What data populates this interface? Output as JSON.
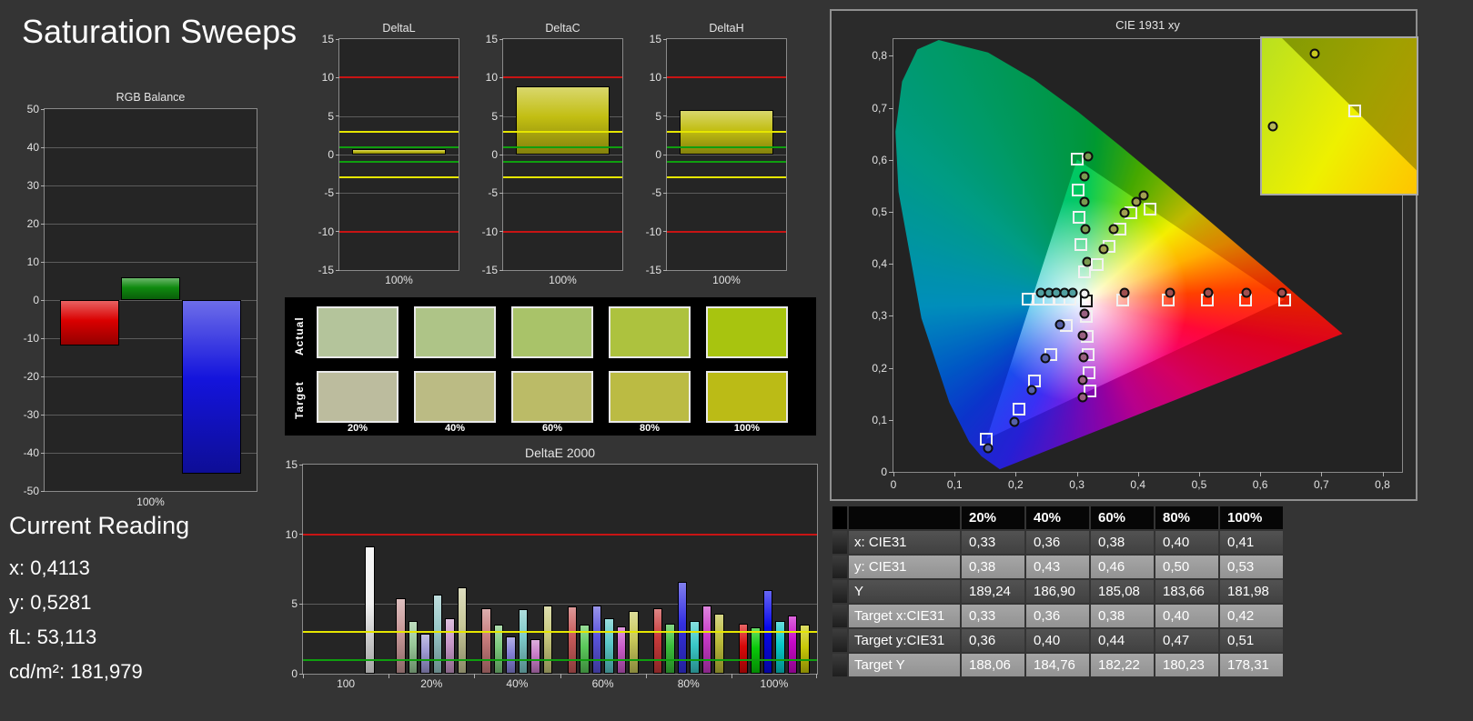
{
  "app": {
    "title": "Saturation Sweeps"
  },
  "current_reading": {
    "heading": "Current Reading",
    "x_label": "x: 0,4113",
    "y_label": "y: 0,5281",
    "fl_label": "fL: 53,113",
    "cdm2_label": "cd/m²: 181,979"
  },
  "colors": {
    "background": "#343434",
    "plot_background": "#252525",
    "reference_red": "#c81414",
    "reference_yellow": "#e6e600",
    "reference_green": "#0f9e0f",
    "grid": "#5c5c5c"
  },
  "chart_data": [
    {
      "id": "rgb_balance",
      "type": "bar",
      "title": "RGB Balance",
      "categories": [
        "Red",
        "Green",
        "Blue"
      ],
      "values": [
        -12,
        6,
        -45.5
      ],
      "bar_colors": [
        "#da0000",
        "#0f8a0f",
        "#1414dc"
      ],
      "ylim": [
        -50,
        50
      ],
      "yticks": [
        -50,
        -40,
        -30,
        -20,
        -10,
        0,
        10,
        20,
        30,
        40,
        50
      ],
      "xlabel": "100%"
    },
    {
      "id": "delta_l",
      "type": "bar",
      "title": "DeltaL",
      "categories": [
        "100%"
      ],
      "values": [
        0.7
      ],
      "bar_colors": [
        "#c2be12"
      ],
      "ylim": [
        -15,
        15
      ],
      "yticks": [
        -15,
        -10,
        -5,
        0,
        5,
        10,
        15
      ],
      "ref_lines": [
        {
          "y": 10,
          "color": "#c81414"
        },
        {
          "y": -10,
          "color": "#c81414"
        },
        {
          "y": 3,
          "color": "#e6e600"
        },
        {
          "y": -3,
          "color": "#e6e600"
        },
        {
          "y": 1,
          "color": "#0f9e0f"
        },
        {
          "y": -1,
          "color": "#0f9e0f"
        }
      ],
      "xlabel": "100%"
    },
    {
      "id": "delta_c",
      "type": "bar",
      "title": "DeltaC",
      "categories": [
        "100%"
      ],
      "values": [
        8.8
      ],
      "bar_colors": [
        "#c2be12"
      ],
      "ylim": [
        -15,
        15
      ],
      "yticks": [
        -15,
        -10,
        -5,
        0,
        5,
        10,
        15
      ],
      "ref_lines": [
        {
          "y": 10,
          "color": "#c81414"
        },
        {
          "y": -10,
          "color": "#c81414"
        },
        {
          "y": 3,
          "color": "#e6e600"
        },
        {
          "y": -3,
          "color": "#e6e600"
        },
        {
          "y": 1,
          "color": "#0f9e0f"
        },
        {
          "y": -1,
          "color": "#0f9e0f"
        }
      ],
      "xlabel": "100%"
    },
    {
      "id": "delta_h",
      "type": "bar",
      "title": "DeltaH",
      "categories": [
        "100%"
      ],
      "values": [
        5.8
      ],
      "bar_colors": [
        "#c2be12"
      ],
      "ylim": [
        -15,
        15
      ],
      "yticks": [
        -15,
        -10,
        -5,
        0,
        5,
        10,
        15
      ],
      "ref_lines": [
        {
          "y": 10,
          "color": "#c81414"
        },
        {
          "y": -10,
          "color": "#c81414"
        },
        {
          "y": 3,
          "color": "#e6e600"
        },
        {
          "y": -3,
          "color": "#e6e600"
        },
        {
          "y": 1,
          "color": "#0f9e0f"
        },
        {
          "y": -1,
          "color": "#0f9e0f"
        }
      ],
      "xlabel": "100%"
    },
    {
      "id": "delta_e2000",
      "type": "bar",
      "title": "DeltaE 2000",
      "ylim": [
        0,
        15
      ],
      "yticks": [
        0,
        5,
        10,
        15
      ],
      "ref_lines": [
        {
          "y": 10,
          "color": "#c81414"
        },
        {
          "y": 3,
          "color": "#e6e600"
        },
        {
          "y": 1,
          "color": "#0f9e0f"
        }
      ],
      "groups": [
        {
          "label": "100",
          "values": [
            9.1
          ],
          "colors": [
            "#f0f0f0"
          ]
        },
        {
          "label": "20%",
          "values": [
            5.4,
            3.8,
            2.9,
            5.7,
            4.0,
            6.2
          ],
          "colors": [
            "#c89898",
            "#98c898",
            "#9c98d2",
            "#98c8c8",
            "#c898c8",
            "#c8c898"
          ]
        },
        {
          "label": "40%",
          "values": [
            4.7,
            3.5,
            2.7,
            4.6,
            2.5,
            4.9
          ],
          "colors": [
            "#c87c7c",
            "#7cc87c",
            "#8480d6",
            "#7cc8c8",
            "#c87cc8",
            "#c8c87c"
          ]
        },
        {
          "label": "60%",
          "values": [
            4.8,
            3.5,
            4.9,
            4.0,
            3.4,
            4.5
          ],
          "colors": [
            "#c85a5a",
            "#5ac85a",
            "#5a54dc",
            "#5ac8c8",
            "#c85ac8",
            "#c8c85a"
          ]
        },
        {
          "label": "80%",
          "values": [
            4.7,
            3.6,
            6.6,
            3.8,
            4.9,
            4.3
          ],
          "colors": [
            "#c83a3a",
            "#3abe3a",
            "#3430e2",
            "#3ac8c8",
            "#c83ac8",
            "#bcbc3a"
          ]
        },
        {
          "label": "100%",
          "values": [
            3.6,
            3.3,
            6.0,
            3.8,
            4.2,
            3.5
          ],
          "colors": [
            "#d80808",
            "#08c808",
            "#0808ec",
            "#08c8c8",
            "#c808c8",
            "#c8c808"
          ]
        }
      ]
    },
    {
      "id": "cie1931",
      "type": "scatter",
      "title": "CIE 1931 xy",
      "xlim": [
        0,
        0.832
      ],
      "ylim": [
        0,
        0.832
      ],
      "xtick_labels": [
        "0",
        "0,1",
        "0,2",
        "0,3",
        "0,4",
        "0,5",
        "0,6",
        "0,7",
        "0,8"
      ],
      "ytick_labels": [
        "0",
        "0,1",
        "0,2",
        "0,3",
        "0,4",
        "0,5",
        "0,6",
        "0,7",
        "0,8"
      ],
      "white_point": [
        0.315,
        0.329
      ],
      "series": [
        {
          "name": "red-targets",
          "marker": "square",
          "points": [
            [
              0.375,
              0.33
            ],
            [
              0.45,
              0.33
            ],
            [
              0.513,
              0.33
            ],
            [
              0.576,
              0.331
            ],
            [
              0.64,
              0.331
            ]
          ]
        },
        {
          "name": "red-measured",
          "marker": "circle",
          "color": "#a05050",
          "points": [
            [
              0.378,
              0.345
            ],
            [
              0.452,
              0.344
            ],
            [
              0.515,
              0.344
            ],
            [
              0.578,
              0.344
            ],
            [
              0.636,
              0.344
            ]
          ]
        },
        {
          "name": "green-targets",
          "marker": "square",
          "points": [
            [
              0.312,
              0.384
            ],
            [
              0.307,
              0.437
            ],
            [
              0.304,
              0.489
            ],
            [
              0.302,
              0.541
            ],
            [
              0.3,
              0.601
            ]
          ]
        },
        {
          "name": "green-measured",
          "marker": "circle",
          "color": "#7a9a50",
          "points": [
            [
              0.317,
              0.403
            ],
            [
              0.314,
              0.466
            ],
            [
              0.313,
              0.52
            ],
            [
              0.313,
              0.568
            ],
            [
              0.319,
              0.607
            ]
          ]
        },
        {
          "name": "blue-targets",
          "marker": "square",
          "points": [
            [
              0.283,
              0.281
            ],
            [
              0.257,
              0.226
            ],
            [
              0.231,
              0.174
            ],
            [
              0.205,
              0.121
            ],
            [
              0.152,
              0.063
            ]
          ]
        },
        {
          "name": "blue-measured",
          "marker": "circle",
          "color": "#5560a8",
          "points": [
            [
              0.272,
              0.283
            ],
            [
              0.249,
              0.218
            ],
            [
              0.226,
              0.158
            ],
            [
              0.198,
              0.097
            ],
            [
              0.155,
              0.045
            ]
          ]
        },
        {
          "name": "cyan-targets",
          "marker": "square",
          "points": [
            [
              0.22,
              0.332
            ],
            [
              0.237,
              0.332
            ],
            [
              0.254,
              0.332
            ],
            [
              0.271,
              0.332
            ],
            [
              0.288,
              0.332
            ]
          ]
        },
        {
          "name": "cyan-measured",
          "marker": "circle",
          "color": "#50a0a0",
          "points": [
            [
              0.241,
              0.345
            ],
            [
              0.254,
              0.345
            ],
            [
              0.267,
              0.345
            ],
            [
              0.28,
              0.345
            ],
            [
              0.293,
              0.345
            ]
          ]
        },
        {
          "name": "magenta-targets",
          "marker": "square",
          "points": [
            [
              0.316,
              0.299
            ],
            [
              0.317,
              0.261
            ],
            [
              0.318,
              0.226
            ],
            [
              0.32,
              0.191
            ],
            [
              0.321,
              0.156
            ]
          ]
        },
        {
          "name": "magenta-measured",
          "marker": "circle",
          "color": "#9a6080",
          "points": [
            [
              0.312,
              0.304
            ],
            [
              0.309,
              0.262
            ],
            [
              0.311,
              0.221
            ],
            [
              0.31,
              0.177
            ],
            [
              0.309,
              0.143
            ]
          ]
        },
        {
          "name": "yellow-targets",
          "marker": "square",
          "points": [
            [
              0.334,
              0.398
            ],
            [
              0.352,
              0.434
            ],
            [
              0.371,
              0.466
            ],
            [
              0.389,
              0.498
            ],
            [
              0.419,
              0.506
            ]
          ]
        },
        {
          "name": "yellow-measured",
          "marker": "circle",
          "color": "#a0a050",
          "points": [
            [
              0.344,
              0.428
            ],
            [
              0.36,
              0.466
            ],
            [
              0.378,
              0.499
            ],
            [
              0.397,
              0.52
            ],
            [
              0.409,
              0.531
            ]
          ]
        },
        {
          "name": "white-target",
          "marker": "square-black",
          "points": [
            [
              0.315,
              0.329
            ]
          ]
        },
        {
          "name": "white-measured",
          "marker": "circle",
          "color": "#f2f2f2",
          "points": [
            [
              0.313,
              0.343
            ]
          ]
        }
      ],
      "inset": {
        "square": [
          0.6,
          0.47
        ],
        "circles": [
          [
            0.34,
            0.1
          ],
          [
            0.07,
            0.57
          ]
        ],
        "circle_colors": [
          "#c8c81e",
          "#b4b45a"
        ]
      }
    }
  ],
  "swatch_panel": {
    "row_labels": [
      "Actual",
      "Target"
    ],
    "col_labels": [
      "20%",
      "40%",
      "60%",
      "80%",
      "100%"
    ],
    "actual_colors": [
      "#b4c49b",
      "#aec487",
      "#a9c369",
      "#adc23e",
      "#a8c40f"
    ],
    "target_colors": [
      "#bcbc9e",
      "#bbbb84",
      "#bbbb67",
      "#bbbb43",
      "#bbbb16"
    ]
  },
  "table": {
    "headers": [
      "20%",
      "40%",
      "60%",
      "80%",
      "100%"
    ],
    "rows": [
      {
        "label": "x: CIE31",
        "values": [
          "0,33",
          "0,36",
          "0,38",
          "0,40",
          "0,41"
        ]
      },
      {
        "label": "y: CIE31",
        "values": [
          "0,38",
          "0,43",
          "0,46",
          "0,50",
          "0,53"
        ]
      },
      {
        "label": "Y",
        "values": [
          "189,24",
          "186,90",
          "185,08",
          "183,66",
          "181,98"
        ]
      },
      {
        "label": "Target x:CIE31",
        "values": [
          "0,33",
          "0,36",
          "0,38",
          "0,40",
          "0,42"
        ]
      },
      {
        "label": "Target y:CIE31",
        "values": [
          "0,36",
          "0,40",
          "0,44",
          "0,47",
          "0,51"
        ]
      },
      {
        "label": "Target Y",
        "values": [
          "188,06",
          "184,76",
          "182,22",
          "180,23",
          "178,31"
        ]
      }
    ]
  }
}
